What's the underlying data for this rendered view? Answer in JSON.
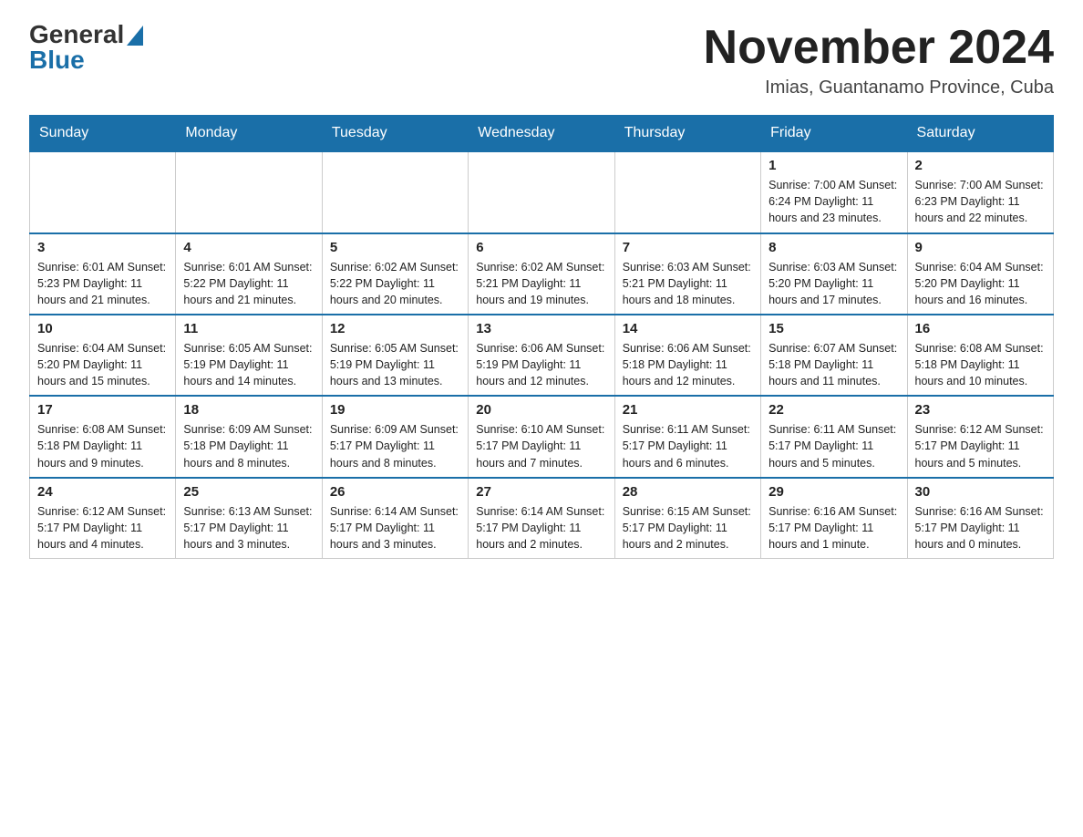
{
  "logo": {
    "general": "General",
    "blue": "Blue"
  },
  "title": "November 2024",
  "subtitle": "Imias, Guantanamo Province, Cuba",
  "days_of_week": [
    "Sunday",
    "Monday",
    "Tuesday",
    "Wednesday",
    "Thursday",
    "Friday",
    "Saturday"
  ],
  "weeks": [
    [
      {
        "day": "",
        "info": ""
      },
      {
        "day": "",
        "info": ""
      },
      {
        "day": "",
        "info": ""
      },
      {
        "day": "",
        "info": ""
      },
      {
        "day": "",
        "info": ""
      },
      {
        "day": "1",
        "info": "Sunrise: 7:00 AM\nSunset: 6:24 PM\nDaylight: 11 hours and 23 minutes."
      },
      {
        "day": "2",
        "info": "Sunrise: 7:00 AM\nSunset: 6:23 PM\nDaylight: 11 hours and 22 minutes."
      }
    ],
    [
      {
        "day": "3",
        "info": "Sunrise: 6:01 AM\nSunset: 5:23 PM\nDaylight: 11 hours and 21 minutes."
      },
      {
        "day": "4",
        "info": "Sunrise: 6:01 AM\nSunset: 5:22 PM\nDaylight: 11 hours and 21 minutes."
      },
      {
        "day": "5",
        "info": "Sunrise: 6:02 AM\nSunset: 5:22 PM\nDaylight: 11 hours and 20 minutes."
      },
      {
        "day": "6",
        "info": "Sunrise: 6:02 AM\nSunset: 5:21 PM\nDaylight: 11 hours and 19 minutes."
      },
      {
        "day": "7",
        "info": "Sunrise: 6:03 AM\nSunset: 5:21 PM\nDaylight: 11 hours and 18 minutes."
      },
      {
        "day": "8",
        "info": "Sunrise: 6:03 AM\nSunset: 5:20 PM\nDaylight: 11 hours and 17 minutes."
      },
      {
        "day": "9",
        "info": "Sunrise: 6:04 AM\nSunset: 5:20 PM\nDaylight: 11 hours and 16 minutes."
      }
    ],
    [
      {
        "day": "10",
        "info": "Sunrise: 6:04 AM\nSunset: 5:20 PM\nDaylight: 11 hours and 15 minutes."
      },
      {
        "day": "11",
        "info": "Sunrise: 6:05 AM\nSunset: 5:19 PM\nDaylight: 11 hours and 14 minutes."
      },
      {
        "day": "12",
        "info": "Sunrise: 6:05 AM\nSunset: 5:19 PM\nDaylight: 11 hours and 13 minutes."
      },
      {
        "day": "13",
        "info": "Sunrise: 6:06 AM\nSunset: 5:19 PM\nDaylight: 11 hours and 12 minutes."
      },
      {
        "day": "14",
        "info": "Sunrise: 6:06 AM\nSunset: 5:18 PM\nDaylight: 11 hours and 12 minutes."
      },
      {
        "day": "15",
        "info": "Sunrise: 6:07 AM\nSunset: 5:18 PM\nDaylight: 11 hours and 11 minutes."
      },
      {
        "day": "16",
        "info": "Sunrise: 6:08 AM\nSunset: 5:18 PM\nDaylight: 11 hours and 10 minutes."
      }
    ],
    [
      {
        "day": "17",
        "info": "Sunrise: 6:08 AM\nSunset: 5:18 PM\nDaylight: 11 hours and 9 minutes."
      },
      {
        "day": "18",
        "info": "Sunrise: 6:09 AM\nSunset: 5:18 PM\nDaylight: 11 hours and 8 minutes."
      },
      {
        "day": "19",
        "info": "Sunrise: 6:09 AM\nSunset: 5:17 PM\nDaylight: 11 hours and 8 minutes."
      },
      {
        "day": "20",
        "info": "Sunrise: 6:10 AM\nSunset: 5:17 PM\nDaylight: 11 hours and 7 minutes."
      },
      {
        "day": "21",
        "info": "Sunrise: 6:11 AM\nSunset: 5:17 PM\nDaylight: 11 hours and 6 minutes."
      },
      {
        "day": "22",
        "info": "Sunrise: 6:11 AM\nSunset: 5:17 PM\nDaylight: 11 hours and 5 minutes."
      },
      {
        "day": "23",
        "info": "Sunrise: 6:12 AM\nSunset: 5:17 PM\nDaylight: 11 hours and 5 minutes."
      }
    ],
    [
      {
        "day": "24",
        "info": "Sunrise: 6:12 AM\nSunset: 5:17 PM\nDaylight: 11 hours and 4 minutes."
      },
      {
        "day": "25",
        "info": "Sunrise: 6:13 AM\nSunset: 5:17 PM\nDaylight: 11 hours and 3 minutes."
      },
      {
        "day": "26",
        "info": "Sunrise: 6:14 AM\nSunset: 5:17 PM\nDaylight: 11 hours and 3 minutes."
      },
      {
        "day": "27",
        "info": "Sunrise: 6:14 AM\nSunset: 5:17 PM\nDaylight: 11 hours and 2 minutes."
      },
      {
        "day": "28",
        "info": "Sunrise: 6:15 AM\nSunset: 5:17 PM\nDaylight: 11 hours and 2 minutes."
      },
      {
        "day": "29",
        "info": "Sunrise: 6:16 AM\nSunset: 5:17 PM\nDaylight: 11 hours and 1 minute."
      },
      {
        "day": "30",
        "info": "Sunrise: 6:16 AM\nSunset: 5:17 PM\nDaylight: 11 hours and 0 minutes."
      }
    ]
  ]
}
